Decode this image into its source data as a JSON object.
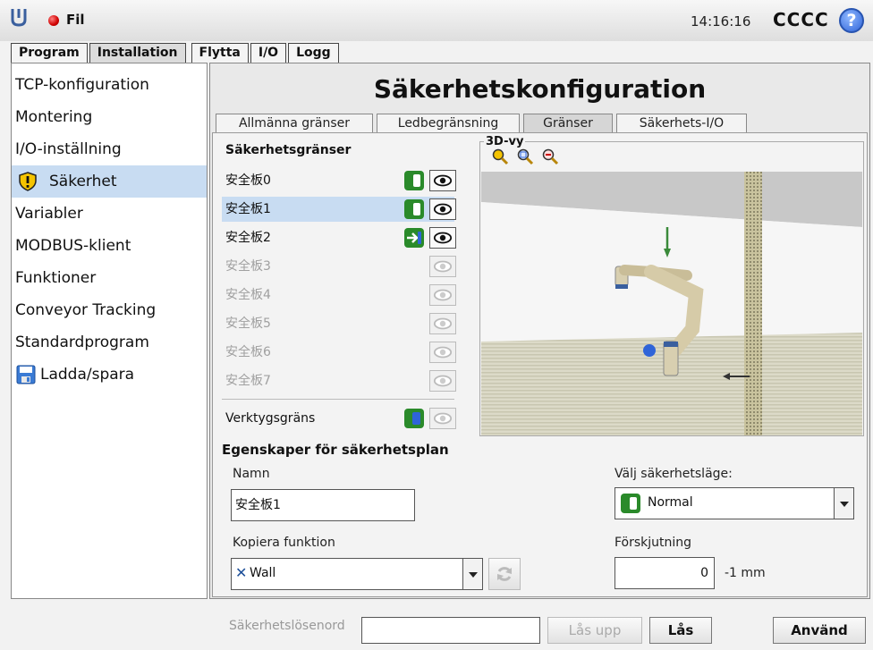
{
  "header": {
    "file_label": "Fil",
    "clock": "14:16:16",
    "user": "CCCC",
    "help_symbol": "?"
  },
  "main_tabs": [
    {
      "label": "Program"
    },
    {
      "label": "Installation"
    },
    {
      "label": "Flytta"
    },
    {
      "label": "I/O"
    },
    {
      "label": "Logg"
    }
  ],
  "sidebar": {
    "items": [
      {
        "label": "TCP-konfiguration"
      },
      {
        "label": "Montering"
      },
      {
        "label": "I/O-inställning"
      },
      {
        "label": "Säkerhet",
        "icon": "warning-shield-icon"
      },
      {
        "label": "Variabler"
      },
      {
        "label": "MODBUS-klient"
      },
      {
        "label": "Funktioner"
      },
      {
        "label": "Conveyor Tracking"
      },
      {
        "label": "Standardprogram"
      },
      {
        "label": "Ladda/spara",
        "icon": "floppy-disk-icon"
      }
    ]
  },
  "page": {
    "title": "Säkerhetskonfiguration"
  },
  "sub_tabs": [
    {
      "label": "Allmänna gränser"
    },
    {
      "label": "Ledbegränsning"
    },
    {
      "label": "Gränser"
    },
    {
      "label": "Säkerhets-I/O"
    }
  ],
  "limits": {
    "heading": "Säkerhetsgränser",
    "planes": [
      {
        "name": "安全板0",
        "state": "normal"
      },
      {
        "name": "安全板1",
        "state": "normal"
      },
      {
        "name": "安全板2",
        "state": "trigger"
      },
      {
        "name": "安全板3",
        "state": "disabled"
      },
      {
        "name": "安全板4",
        "state": "disabled"
      },
      {
        "name": "安全板5",
        "state": "disabled"
      },
      {
        "name": "安全板6",
        "state": "disabled"
      },
      {
        "name": "安全板7",
        "state": "disabled"
      }
    ],
    "tool_limit": "Verktygsgräns"
  },
  "view3d": {
    "label": "3D-vy"
  },
  "properties": {
    "heading": "Egenskaper för säkerhetsplan",
    "name_label": "Namn",
    "name_value": "安全板1",
    "mode_label": "Välj säkerhetsläge:",
    "mode_value": "Normal",
    "copy_label": "Kopiera funktion",
    "copy_value": "Wall",
    "offset_label": "Förskjutning",
    "offset_value": "0",
    "offset_unit": "-1 mm"
  },
  "footer": {
    "password_label": "Säkerhetslösenord",
    "unlock_label": "Lås upp",
    "lock_label": "Lås",
    "apply_label": "Använd"
  },
  "colors": {
    "accent_selected": "#c8dcf2",
    "toggle_green": "#2a8a2a",
    "help_blue": "#2f64d8"
  }
}
